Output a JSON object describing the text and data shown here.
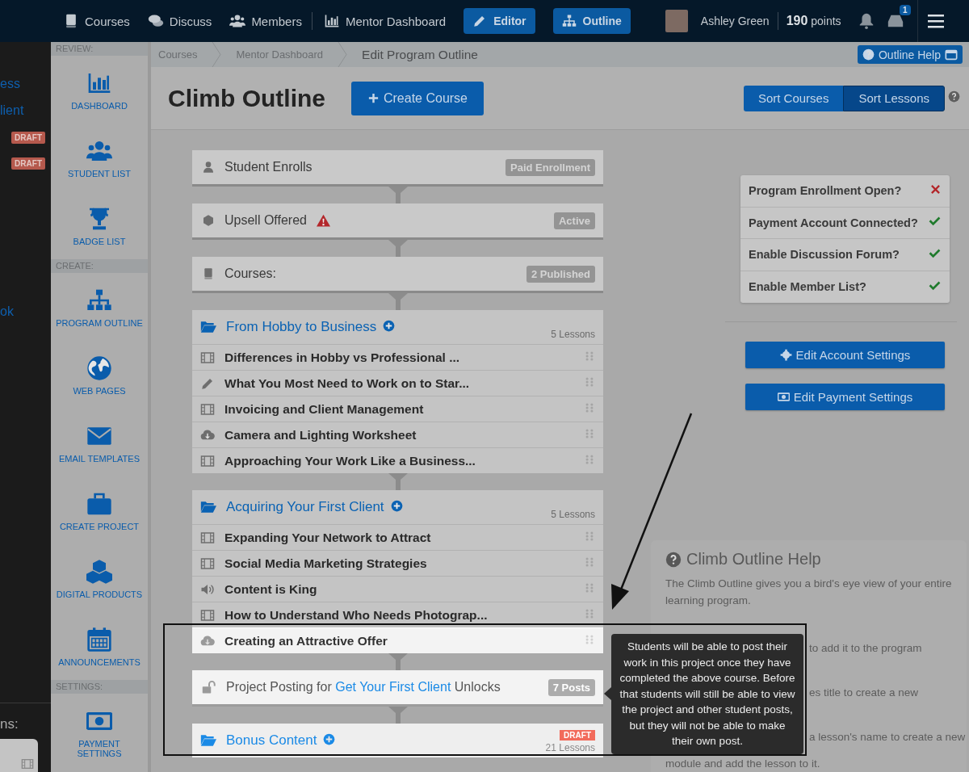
{
  "top_nav": {
    "links": [
      {
        "label": "Courses",
        "kind": "book"
      },
      {
        "label": "Discuss",
        "kind": "chat"
      },
      {
        "label": "Members",
        "kind": "users"
      },
      {
        "label": "Mentor Dashboard",
        "kind": "chart"
      }
    ],
    "mode_buttons": [
      {
        "label": "Editor",
        "kind": "pencil"
      },
      {
        "label": "Outline",
        "kind": "sitemap"
      }
    ],
    "user": {
      "name": "Ashley Green",
      "points": "190",
      "points_label": "points"
    },
    "inbox_count": "1"
  },
  "left_panel": {
    "items": [
      {
        "kind": "link",
        "text": "ess"
      },
      {
        "kind": "link",
        "text": "lient"
      },
      {
        "kind": "badge",
        "text": "DRAFT"
      },
      {
        "kind": "badge",
        "text": "DRAFT"
      },
      {
        "kind": "link",
        "text": "ok"
      }
    ],
    "footer": "ns:"
  },
  "sidebar": {
    "sections": [
      {
        "title": "REVIEW:",
        "items": [
          {
            "label": "DASHBOARD",
            "kind": "chart"
          },
          {
            "label": "STUDENT LIST",
            "kind": "users"
          },
          {
            "label": "BADGE LIST",
            "kind": "trophy"
          }
        ]
      },
      {
        "title": "CREATE:",
        "items": [
          {
            "label": "PROGRAM OUTLINE",
            "kind": "sitemap"
          },
          {
            "label": "WEB PAGES",
            "kind": "globe"
          },
          {
            "label": "EMAIL TEMPLATES",
            "kind": "envelope"
          },
          {
            "label": "CREATE PROJECT",
            "kind": "briefcase"
          },
          {
            "label": "DIGITAL PRODUCTS",
            "kind": "cubes"
          },
          {
            "label": "ANNOUNCEMENTS",
            "kind": "calendar"
          }
        ]
      },
      {
        "title": "SETTINGS:",
        "items": [
          {
            "label": "PAYMENT SETTINGS",
            "kind": "money"
          }
        ]
      }
    ]
  },
  "breadcrumbs": [
    "Courses",
    "Mentor Dashboard",
    "Edit Program Outline"
  ],
  "help_button": "Outline Help",
  "page_title": "Climb Outline",
  "create_button": "Create Course",
  "sort_buttons": [
    {
      "label": "Sort Courses",
      "selected": false
    },
    {
      "label": "Sort Lessons",
      "selected": true
    }
  ],
  "outline": [
    {
      "kind": "enrollment",
      "title": "Student Enrolls",
      "badge": "Paid Enrollment",
      "highlighted": false
    },
    {
      "kind": "upsell",
      "title": "Upsell Offered",
      "warning": true,
      "badge": "Active",
      "highlighted": false
    },
    {
      "kind": "courses",
      "title": "Courses:",
      "badge": "2 Published",
      "highlighted": false
    },
    {
      "kind": "course",
      "title": "From Hobby to Business",
      "count": "5 Lessons",
      "highlighted": false,
      "lessons": [
        {
          "title": "Differences in Hobby vs Professional ...",
          "kind": "video",
          "highlighted": false
        },
        {
          "title": "What You Most Need to Work on to Star...",
          "kind": "text",
          "highlighted": false
        },
        {
          "title": "Invoicing and Client Management",
          "kind": "video",
          "highlighted": false
        },
        {
          "title": "Camera and Lighting Worksheet",
          "kind": "download",
          "highlighted": false
        },
        {
          "title": "Approaching Your Work Like a Business...",
          "kind": "video",
          "highlighted": false
        }
      ]
    },
    {
      "kind": "course",
      "title": "Acquiring Your First Client",
      "count": "5 Lessons",
      "highlighted": false,
      "lessons": [
        {
          "title": "Expanding Your Network to Attract",
          "kind": "video",
          "highlighted": false
        },
        {
          "title": "Social Media Marketing Strategies",
          "kind": "video",
          "highlighted": false
        },
        {
          "title": "Content is King",
          "kind": "audio",
          "highlighted": false
        },
        {
          "title": "How to Understand Who Needs Photograp...",
          "kind": "video",
          "highlighted": false
        },
        {
          "title": "Creating an Attractive Offer",
          "kind": "download",
          "highlighted": true
        }
      ]
    },
    {
      "kind": "project",
      "prefix": "Project Posting for",
      "link": "Get Your First Client",
      "suffix": "Unlocks",
      "badge": "7 Posts",
      "highlighted": true
    },
    {
      "kind": "course",
      "title": "Bonus Content",
      "badge": "DRAFT",
      "count": "21 Lessons",
      "highlighted": true
    }
  ],
  "checklist": [
    {
      "label": "Program Enrollment Open?",
      "checked": false
    },
    {
      "label": "Payment Account Connected?",
      "checked": true
    },
    {
      "label": "Enable Discussion Forum?",
      "checked": true
    },
    {
      "label": "Enable Member List?",
      "checked": true
    }
  ],
  "settings_buttons": [
    {
      "label": "Edit Account Settings",
      "kind": "gear"
    },
    {
      "label": "Edit Payment Settings",
      "kind": "money"
    }
  ],
  "help": {
    "title": "Climb Outline Help",
    "paragraphs": [
      "The Climb Outline gives you a bird's eye view of your entire learning program.",
      "to add it to the program",
      "es title to create a new",
      "a lesson's name to create a new",
      "module and add the lesson to it."
    ]
  },
  "tooltip": "Students will be able to post their work in this project once they have completed the above course. Before that students will still be able to view the project and other student posts, but they will not be able to make their own post."
}
